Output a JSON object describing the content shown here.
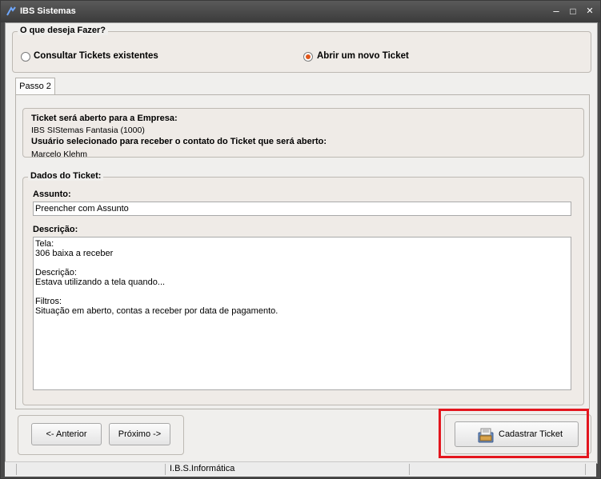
{
  "window": {
    "title": "IBS Sistemas",
    "min_glyph": "–",
    "max_glyph": "□",
    "close_glyph": "✕"
  },
  "action_group": {
    "title": "O que deseja Fazer?",
    "option_consult": "Consultar Tickets existentes",
    "option_new": "Abrir um novo Ticket",
    "selected": "option_new"
  },
  "tab": {
    "label": "Passo 2"
  },
  "company_info": {
    "company_heading": "Ticket será aberto para a Empresa:",
    "company_value": "IBS SIStemas Fantasia (1000)",
    "user_heading": "Usuário selecionado para receber o contato do Ticket que será aberto:",
    "user_value": "Marcelo Klehm"
  },
  "ticket_data": {
    "group_title": "Dados do Ticket:",
    "subject_label": "Assunto:",
    "subject_value": "Preencher com Assunto",
    "description_label": "Descrição:",
    "description_lines": [
      "Tela:",
      "306 baixa a receber",
      "",
      "Descrição:",
      "Estava utilizando a tela quando...",
      "",
      "Filtros:",
      "Situação em aberto, contas a receber por data de pagamento."
    ]
  },
  "nav": {
    "previous_label": "<- Anterior",
    "next_label": "Próximo ->"
  },
  "submit": {
    "label": "Cadastrar Ticket"
  },
  "status_bar": {
    "company_text": "I.B.S.Informática"
  },
  "colors": {
    "highlight": "#e3161e",
    "radio_selected": "#e0561b"
  }
}
